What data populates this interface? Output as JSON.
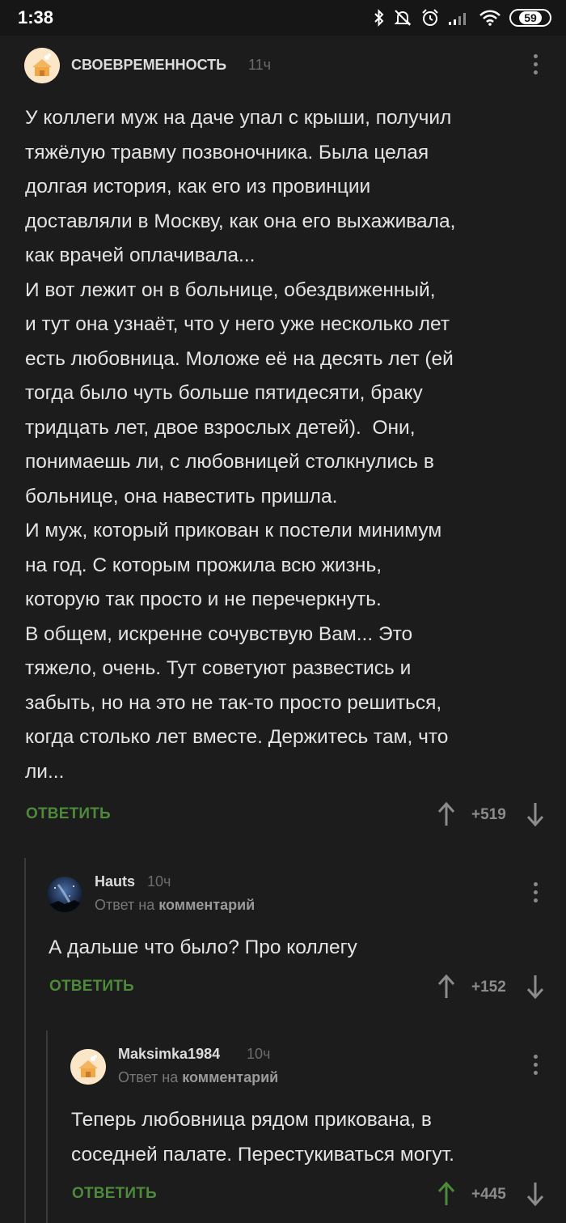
{
  "status_bar": {
    "time": "1:38",
    "battery": "59",
    "icons": [
      "bluetooth-icon",
      "mute-icon",
      "alarm-icon",
      "signal-icon",
      "wifi-icon",
      "battery-icon"
    ]
  },
  "colors": {
    "background": "#1c1c1d",
    "reply_green": "#4d8a3a",
    "upvoted_green": "#4d8a3a"
  },
  "comments": [
    {
      "author": "СВОЕВРЕМЕННОСТЬ",
      "time": "11ч",
      "text_lines": [
        "У коллеги муж на даче упал с крыши, получил",
        "тяжёлую травму позвоночника. Была целая",
        "долгая история, как его из провинции",
        "доставляли в Москву, как она его выхаживала,",
        "как врачей оплачивала...",
        "И вот лежит он в больнице, обездвиженный,",
        "и тут она узнаёт, что у него уже несколько лет",
        "есть любовница. Моложе её на десять лет (ей",
        "тогда было чуть больше пятидесяти, браку",
        "тридцать лет, двое взрослых детей).  Они,",
        "понимаешь ли, с любовницей столкнулись в",
        "больнице, она навестить пришла.",
        "И муж, который прикован к постели минимум",
        "на год. С которым прожила всю жизнь,",
        "которую так просто и не перечеркнуть.",
        "В общем, искренне сочувствую Вам... Это",
        "тяжело, очень. Тут советуют развестись и",
        "забыть, но на это не так-то просто решиться,",
        "когда столько лет вместе. Держитесь там, что",
        "ли..."
      ],
      "reply_label": "ОТВЕТИТЬ",
      "score": "+519",
      "upvoted": false
    },
    {
      "author": "Hauts",
      "time": "10ч",
      "reply_prefix": "Ответ на",
      "reply_target": "комментарий",
      "text_lines": [
        "А дальше что было? Про коллегу"
      ],
      "reply_label": "ОТВЕТИТЬ",
      "score": "+152",
      "upvoted": false
    },
    {
      "author": "Maksimka1984",
      "time": "10ч",
      "reply_prefix": "Ответ на",
      "reply_target": "комментарий",
      "text_lines": [
        "Теперь любовница рядом прикована, в",
        "соседней палате. Перестукиваться могут."
      ],
      "reply_label": "ОТВЕТИТЬ",
      "score": "+445",
      "upvoted": true
    }
  ]
}
